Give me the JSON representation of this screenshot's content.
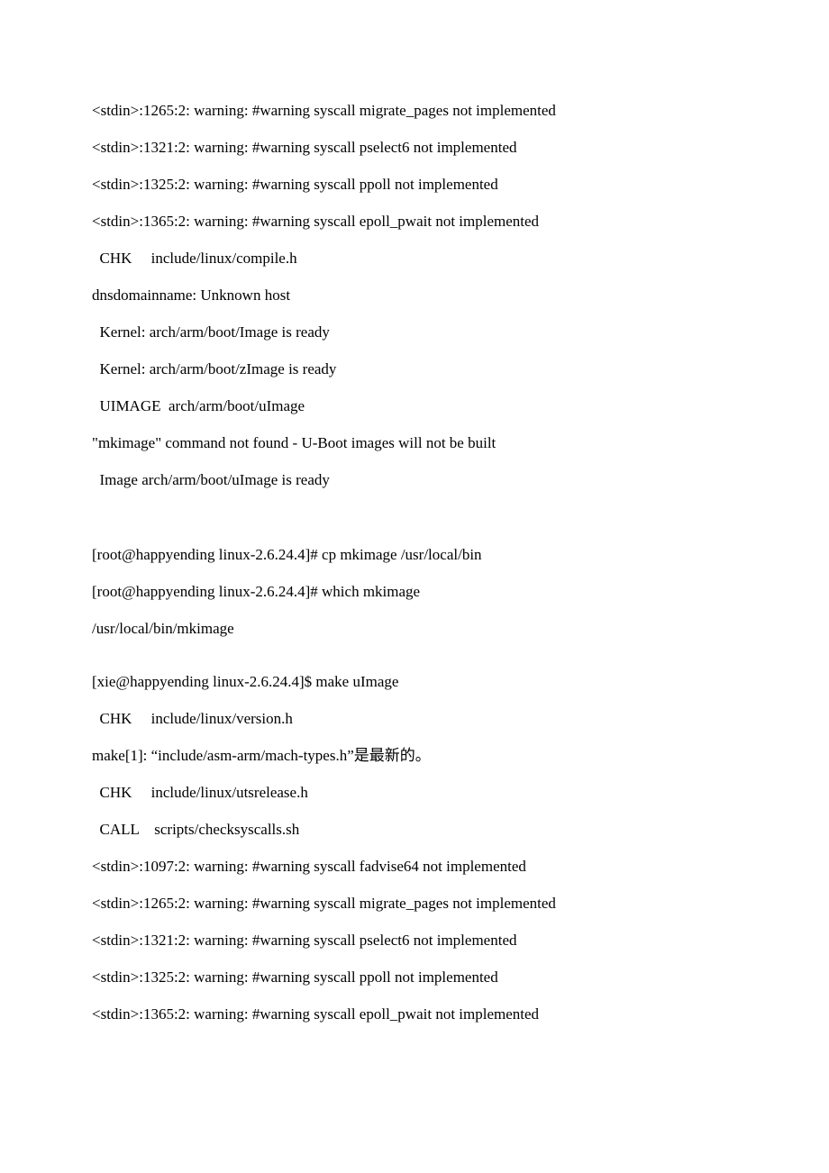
{
  "lines": [
    "<stdin>:1265:2: warning: #warning syscall migrate_pages not implemented",
    "<stdin>:1321:2: warning: #warning syscall pselect6 not implemented",
    "<stdin>:1325:2: warning: #warning syscall ppoll not implemented",
    "<stdin>:1365:2: warning: #warning syscall epoll_pwait not implemented",
    "  CHK     include/linux/compile.h",
    "dnsdomainname: Unknown host",
    "  Kernel: arch/arm/boot/Image is ready",
    "  Kernel: arch/arm/boot/zImage is ready",
    "  UIMAGE  arch/arm/boot/uImage",
    "\"mkimage\" command not found - U-Boot images will not be built",
    "  Image arch/arm/boot/uImage is ready"
  ],
  "lines2": [
    "[root@happyending linux-2.6.24.4]# cp mkimage /usr/local/bin",
    "[root@happyending linux-2.6.24.4]# which mkimage",
    "/usr/local/bin/mkimage"
  ],
  "lines3": [
    "[xie@happyending linux-2.6.24.4]$ make uImage",
    "  CHK     include/linux/version.h",
    "make[1]: “include/asm-arm/mach-types.h”是最新的。",
    "  CHK     include/linux/utsrelease.h",
    "  CALL    scripts/checksyscalls.sh",
    "<stdin>:1097:2: warning: #warning syscall fadvise64 not implemented",
    "<stdin>:1265:2: warning: #warning syscall migrate_pages not implemented",
    "<stdin>:1321:2: warning: #warning syscall pselect6 not implemented",
    "<stdin>:1325:2: warning: #warning syscall ppoll not implemented",
    "<stdin>:1365:2: warning: #warning syscall epoll_pwait not implemented"
  ]
}
